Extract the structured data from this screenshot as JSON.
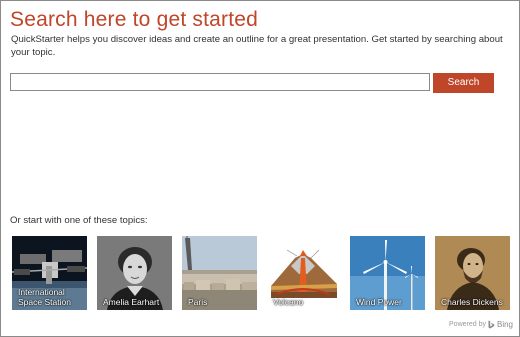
{
  "header": {
    "title": "Search here to get started",
    "description": "QuickStarter helps you discover ideas and create an outline for a great presentation. Get started by searching about your topic."
  },
  "search": {
    "value": "",
    "placeholder": "",
    "button_label": "Search"
  },
  "topics": {
    "label": "Or start with one of these topics:",
    "items": [
      {
        "label": "International Space Station",
        "icon": "space-station-image"
      },
      {
        "label": "Amelia Earhart",
        "icon": "portrait-image"
      },
      {
        "label": "Paris",
        "icon": "eiffel-tower-image"
      },
      {
        "label": "Volcano",
        "icon": "volcano-diagram-image"
      },
      {
        "label": "Wind Power",
        "icon": "wind-turbine-image"
      },
      {
        "label": "Charles Dickens",
        "icon": "portrait-image"
      }
    ]
  },
  "footer": {
    "powered_by": "Powered by",
    "brand": "Bing"
  },
  "colors": {
    "accent": "#c0462a",
    "text": "#333333",
    "border": "#8a8a8a"
  }
}
